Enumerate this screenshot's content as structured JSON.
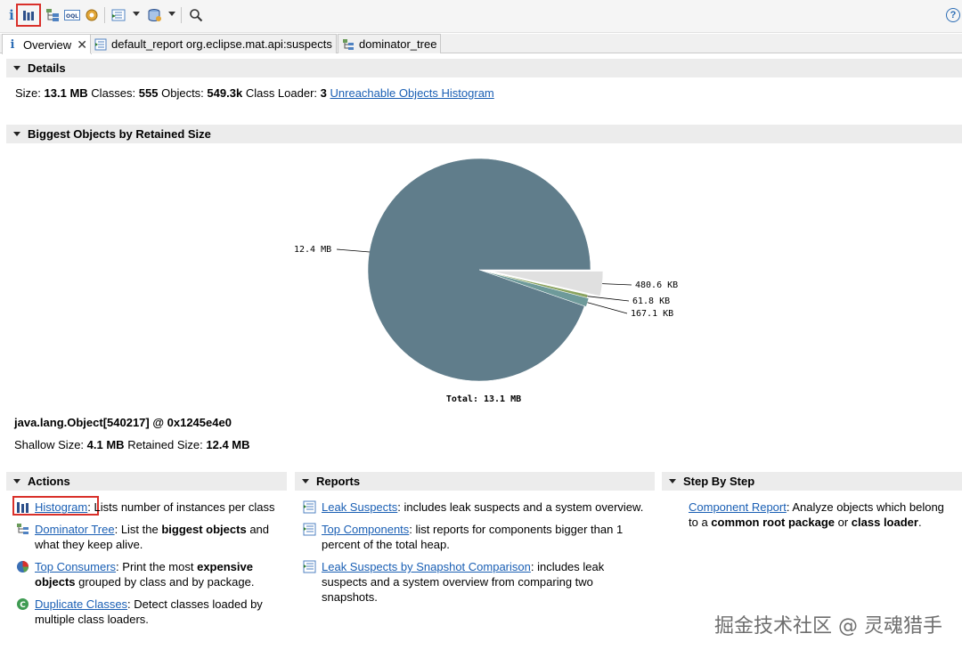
{
  "toolbar": {
    "items": [
      "info-icon",
      "histogram-icon",
      "dominator-tree-icon",
      "oql-icon",
      "heap-dump-icon",
      "query-browser-icon",
      "find-object-icon",
      "search-icon"
    ],
    "oql_label": "OQL"
  },
  "tabs": [
    {
      "label": "Overview",
      "active": true
    },
    {
      "label": "default_report org.eclipse.mat.api:suspects",
      "active": false
    },
    {
      "label": "dominator_tree",
      "active": false
    }
  ],
  "details": {
    "header": "Details",
    "size_label": "Size:",
    "size_value": "13.1 MB",
    "classes_label": "Classes:",
    "classes_value": "555",
    "objects_label": "Objects:",
    "objects_value": "549.3k",
    "loader_label": "Class Loader:",
    "loader_value": "3",
    "unreachable_link": "Unreachable Objects Histogram"
  },
  "biggest": {
    "header": "Biggest Objects by Retained Size",
    "object_name": "java.lang.Object[540217] @ 0x1245e4e0",
    "shallow_label": "Shallow Size:",
    "shallow_value": "4.1 MB",
    "retained_label": "Retained Size:",
    "retained_value": "12.4 MB"
  },
  "chart_data": {
    "type": "pie",
    "slices": [
      {
        "label": "12.4 MB",
        "value_kb": 12697.6,
        "color": "#607d8b"
      },
      {
        "label": "480.6 KB",
        "value_kb": 480.6,
        "color": "#e0e0e0"
      },
      {
        "label": "61.8 KB",
        "value_kb": 61.8,
        "color": "#8aa35e"
      },
      {
        "label": "167.1 KB",
        "value_kb": 167.1,
        "color": "#6e9a9a"
      }
    ],
    "total_label": "Total: 13.1 MB"
  },
  "actions": {
    "header": "Actions",
    "histogram_link": "Histogram",
    "histogram_desc": ": Lists number of instances per class",
    "dominator_link": "Dominator Tree",
    "dominator_desc_1": ": List the ",
    "dominator_bold": "biggest objects",
    "dominator_desc_2": " and",
    "dominator_desc_3": "what they keep alive.",
    "consumers_link": "Top Consumers",
    "consumers_desc_1": ": Print the most ",
    "consumers_bold_1": "expensive",
    "consumers_bold_2": "objects",
    "consumers_desc_2": " grouped by class and by package.",
    "duplicate_link": "Duplicate Classes",
    "duplicate_desc_1": ": Detect classes loaded by",
    "duplicate_desc_2": "multiple class loaders."
  },
  "reports": {
    "header": "Reports",
    "leak_link": "Leak Suspects",
    "leak_desc": ": includes leak suspects and a system overview.",
    "components_link": "Top Components",
    "components_desc_1": ": list reports for components bigger than 1",
    "components_desc_2": "percent of the total heap.",
    "snapshot_link": "Leak Suspects by Snapshot Comparison",
    "snapshot_desc_1": ": includes leak",
    "snapshot_desc_2": "suspects and a system overview from comparing two",
    "snapshot_desc_3": "snapshots."
  },
  "stepbystep": {
    "header": "Step By Step",
    "component_link": "Component Report",
    "component_desc_1": ": Analyze objects which belong",
    "component_desc_2a": "to a ",
    "component_bold_1": "common root package",
    "component_desc_2b": " or ",
    "component_bold_2": "class loader",
    "component_desc_2c": "."
  },
  "watermark": "掘金技术社区 @ 灵魂猎手",
  "colors": {
    "link": "#1a5fb4",
    "highlight": "#d9302a",
    "pie_main": "#607d8b"
  }
}
